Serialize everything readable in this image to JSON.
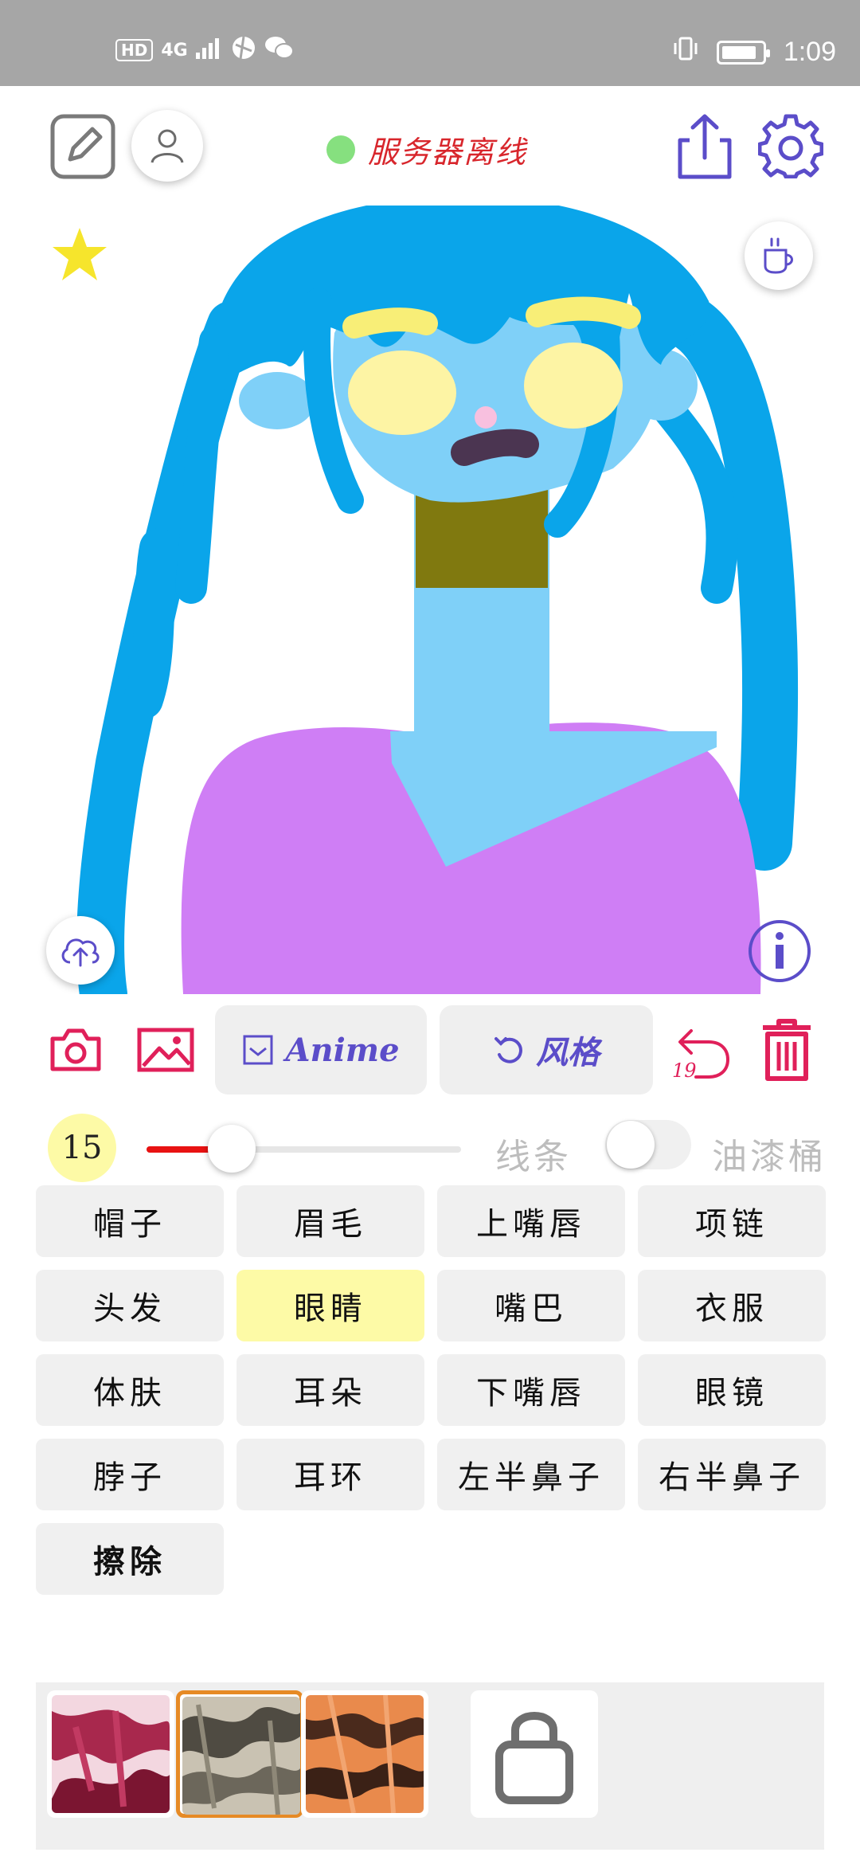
{
  "status_bar": {
    "hd": "HD",
    "network": "4G",
    "time": "1:09"
  },
  "header": {
    "server_status": "服务器离线",
    "server_status_color": "#86e07f"
  },
  "toolbar": {
    "anime_label": "Anime",
    "style_label": "风格",
    "undo_count": "19"
  },
  "brush": {
    "size": "15",
    "line_label": "线条",
    "bucket_label": "油漆桶",
    "bucket_enabled": false,
    "slider_fraction": 0.27
  },
  "parts": [
    {
      "label": "帽子",
      "selected": false
    },
    {
      "label": "眉毛",
      "selected": false
    },
    {
      "label": "上嘴唇",
      "selected": false
    },
    {
      "label": "项链",
      "selected": false
    },
    {
      "label": "头发",
      "selected": false
    },
    {
      "label": "眼睛",
      "selected": true
    },
    {
      "label": "嘴巴",
      "selected": false
    },
    {
      "label": "衣服",
      "selected": false
    },
    {
      "label": "体肤",
      "selected": false
    },
    {
      "label": "耳朵",
      "selected": false
    },
    {
      "label": "下嘴唇",
      "selected": false
    },
    {
      "label": "眼镜",
      "selected": false
    },
    {
      "label": "脖子",
      "selected": false
    },
    {
      "label": "耳环",
      "selected": false
    },
    {
      "label": "左半鼻子",
      "selected": false
    },
    {
      "label": "右半鼻子",
      "selected": false
    },
    {
      "label": "擦除",
      "selected": false
    }
  ],
  "colors": {
    "accent_red": "#e81212",
    "icon_purple": "#5b4dc9",
    "selected_yellow": "#fdfaa6"
  }
}
